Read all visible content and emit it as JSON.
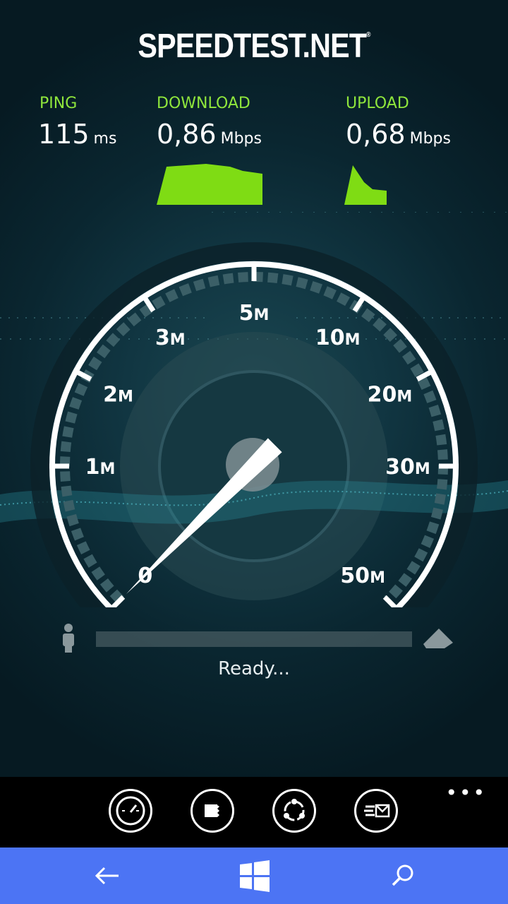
{
  "brand": {
    "logo_text": "SPEEDTEST.NET",
    "reg_mark": "®"
  },
  "metrics": {
    "ping": {
      "label": "PING",
      "value": "115",
      "unit": "ms"
    },
    "download": {
      "label": "DOWNLOAD",
      "value": "0,86",
      "unit": "Mbps"
    },
    "upload": {
      "label": "UPLOAD",
      "value": "0,68",
      "unit": "Mbps"
    }
  },
  "gauge": {
    "labels": [
      "0",
      "1M",
      "2M",
      "3M",
      "5M",
      "10M",
      "20M",
      "30M",
      "50M"
    ],
    "needle_label_index": 0
  },
  "status": {
    "text": "Ready..."
  },
  "appbar": {
    "buttons": [
      "speedometer-icon",
      "flag-icon",
      "share-icon",
      "feedback-icon"
    ],
    "more": "•••"
  },
  "navbar": {
    "items": [
      "back-arrow-icon",
      "windows-icon",
      "search-icon"
    ]
  },
  "colors": {
    "accent_green": "#8fe63c",
    "nav_blue": "#4c74f4"
  }
}
